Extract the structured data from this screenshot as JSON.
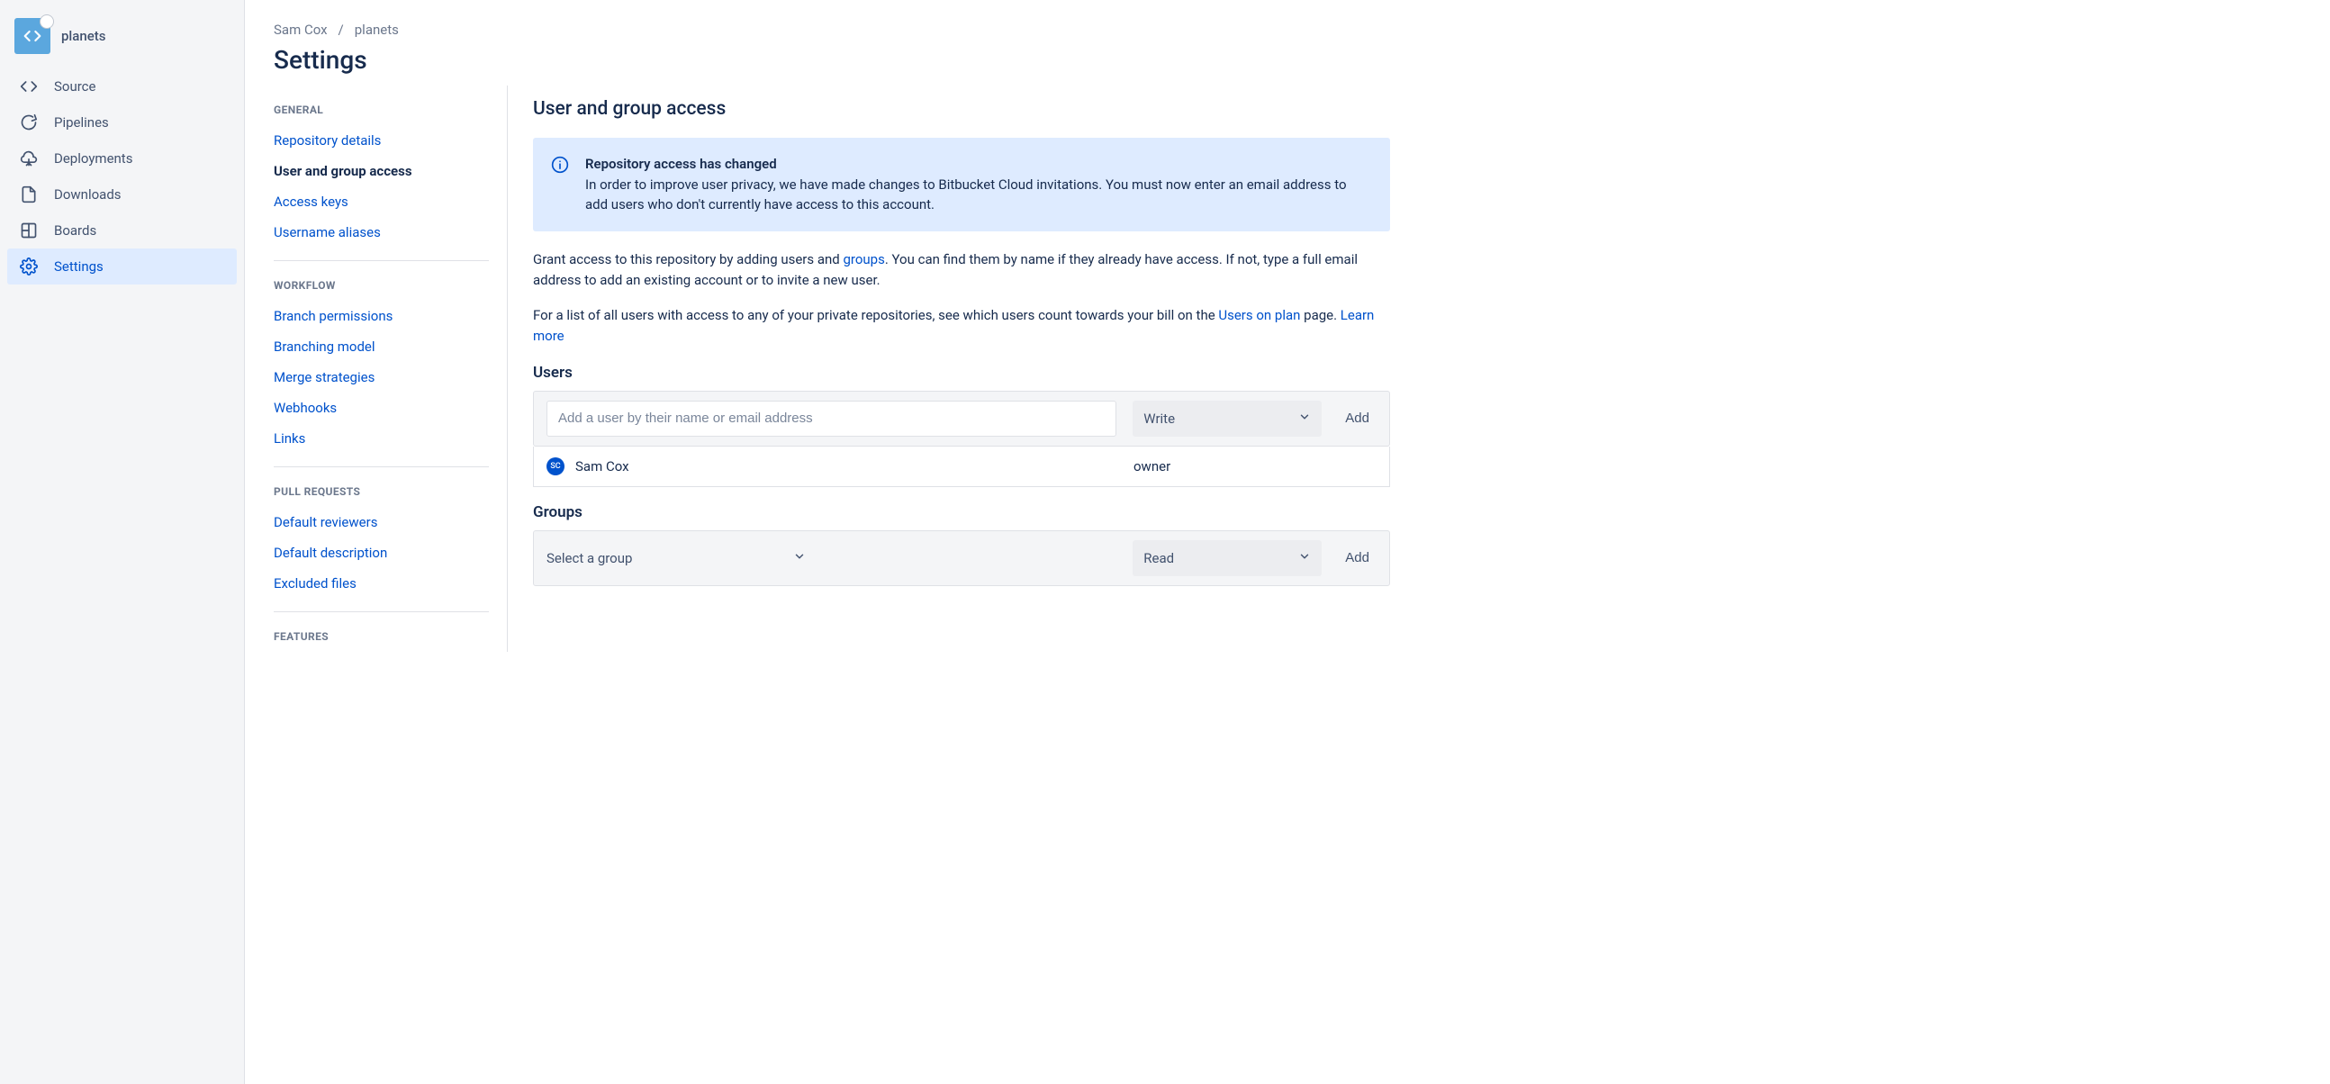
{
  "sidebar": {
    "repo_name": "planets",
    "items": [
      {
        "label": "Source"
      },
      {
        "label": "Pipelines"
      },
      {
        "label": "Deployments"
      },
      {
        "label": "Downloads"
      },
      {
        "label": "Boards"
      },
      {
        "label": "Settings"
      }
    ]
  },
  "breadcrumb": {
    "owner": "Sam Cox",
    "repo": "planets"
  },
  "page_title": "Settings",
  "settings_nav": {
    "general": {
      "header": "GENERAL",
      "items": [
        "Repository details",
        "User and group access",
        "Access keys",
        "Username aliases"
      ]
    },
    "workflow": {
      "header": "WORKFLOW",
      "items": [
        "Branch permissions",
        "Branching model",
        "Merge strategies",
        "Webhooks",
        "Links"
      ]
    },
    "prs": {
      "header": "PULL REQUESTS",
      "items": [
        "Default reviewers",
        "Default description",
        "Excluded files"
      ]
    },
    "features": {
      "header": "FEATURES"
    }
  },
  "panel": {
    "title": "User and group access",
    "info": {
      "title": "Repository access has changed",
      "body": "In order to improve user privacy, we have made changes to Bitbucket Cloud invitations. You must now enter an email address to add users who don't currently have access to this account."
    },
    "body1_pre": "Grant access to this repository by adding users and ",
    "body1_link": "groups",
    "body1_post": ". You can find them by name if they already have access. If not, type a full email address to add an existing account or to invite a new user.",
    "body2_pre": "For a list of all users with access to any of your private repositories, see which users count towards your bill on the ",
    "body2_link": "Users on plan",
    "body2_mid": " page. ",
    "body2_learn": "Learn more",
    "users_heading": "Users",
    "user_input_placeholder": "Add a user by their name or email address",
    "user_permission_selected": "Write",
    "add_button": "Add",
    "users": [
      {
        "initials": "SC",
        "name": "Sam Cox",
        "role": "owner"
      }
    ],
    "groups_heading": "Groups",
    "group_select_placeholder": "Select a group",
    "group_permission_selected": "Read"
  }
}
